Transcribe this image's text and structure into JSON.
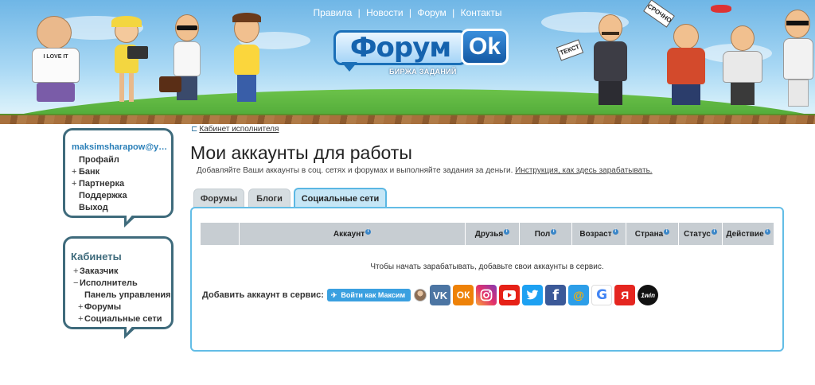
{
  "topnav": {
    "links": [
      "Правила",
      "Новости",
      "Форум",
      "Контакты"
    ],
    "separator": "|"
  },
  "logo": {
    "main": "Форум",
    "ok": "Ok",
    "subtitle": "БИРЖА ЗАДАНИЙ"
  },
  "banner": {
    "shirt_text": "I LOVE IT",
    "sign_urgent": "СРОЧНО",
    "sign_ask": "ТЕКСТ"
  },
  "sidebar": {
    "user_email": "maksimsharapow@yan...",
    "user_menu": [
      {
        "prefix": "",
        "label": "Профайл"
      },
      {
        "prefix": "+",
        "label": "Банк"
      },
      {
        "prefix": "+",
        "label": "Партнерка"
      },
      {
        "prefix": "",
        "label": "Поддержка"
      },
      {
        "prefix": "",
        "label": "Выход"
      }
    ],
    "cabinets_title": "Кабинеты",
    "cabinets": [
      {
        "prefix": "+",
        "label": "Заказчик",
        "indent": 0
      },
      {
        "prefix": "−",
        "label": "Исполнитель",
        "indent": 0
      },
      {
        "prefix": "",
        "label": "Панель управления",
        "indent": 1
      },
      {
        "prefix": "+",
        "label": "Форумы",
        "indent": 1
      },
      {
        "prefix": "+",
        "label": "Социальные сети",
        "indent": 1
      }
    ]
  },
  "breadcrumb": {
    "link": "Кабинет исполнителя"
  },
  "page": {
    "title": "Мои аккаунты для работы",
    "subtitle_text": "Добавляйте Ваши аккаунты в соц. сетях и форумах и выполняйте задания за деньги.",
    "subtitle_link": "Инструкция, как здесь зарабатывать."
  },
  "tabs": [
    {
      "label": "Форумы",
      "active": false
    },
    {
      "label": "Блоги",
      "active": false
    },
    {
      "label": "Социальные сети",
      "active": true
    }
  ],
  "table": {
    "columns": [
      "",
      "Аккаунт",
      "Друзья",
      "Пол",
      "Возраст",
      "Страна",
      "Статус",
      "Действие"
    ],
    "empty_message": "Чтобы начать зарабатывать, добавьте свои аккаунты в сервис."
  },
  "add_service": {
    "label": "Добавить аккаунт в сервис:",
    "telegram_button": "Войти как Максим",
    "services": [
      {
        "name": "vk",
        "icon": "vk-icon",
        "glyph": "VK",
        "color": "#4c75a3"
      },
      {
        "name": "odnoklassniki",
        "icon": "odnoklassniki-icon",
        "glyph": "ОК",
        "color": "#ee8208"
      },
      {
        "name": "instagram",
        "icon": "instagram-icon",
        "glyph": "",
        "color": "#c13584"
      },
      {
        "name": "youtube",
        "icon": "youtube-icon",
        "glyph": "",
        "color": "#e62117"
      },
      {
        "name": "twitter",
        "icon": "twitter-icon",
        "glyph": "",
        "color": "#1da1f2"
      },
      {
        "name": "facebook",
        "icon": "facebook-icon",
        "glyph": "f",
        "color": "#3b5998"
      },
      {
        "name": "mail",
        "icon": "mailru-icon",
        "glyph": "@",
        "color": "#2d9ee8"
      },
      {
        "name": "google",
        "icon": "google-icon",
        "glyph": "G",
        "color": "#ffffff"
      },
      {
        "name": "yandex",
        "icon": "yandex-icon",
        "glyph": "Я",
        "color": "#e52620"
      },
      {
        "name": "1win",
        "icon": "1win-icon",
        "glyph": "1win",
        "color": "#111111"
      }
    ]
  }
}
